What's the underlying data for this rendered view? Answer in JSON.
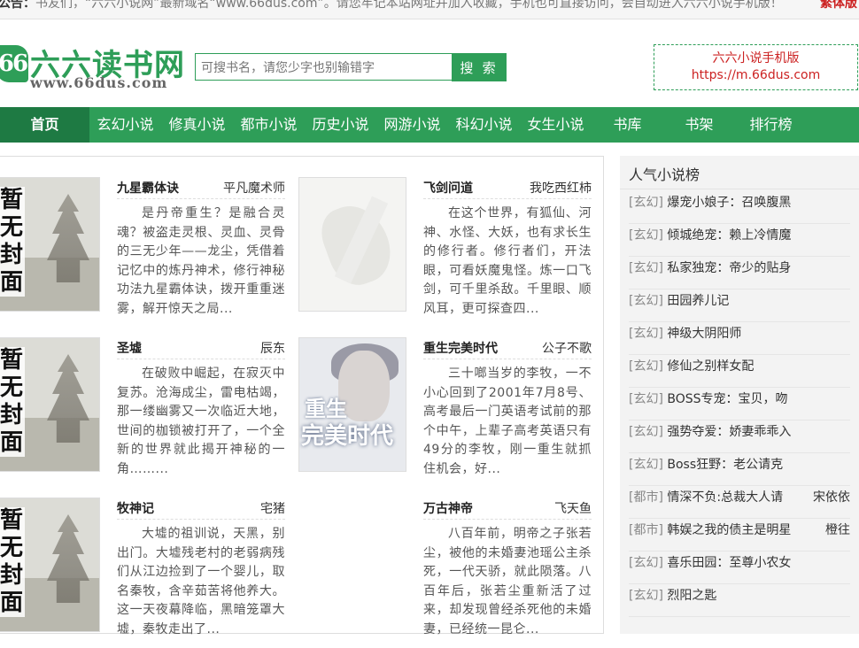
{
  "notice": {
    "prefix": "公告：",
    "text": "书友们，“六六小说网”最新域名“www.66dus.com”。请您牢记本站网址并加入收藏，手机也可直接访问，会自动进入六六小说手机版！",
    "trad_link": "繁体版"
  },
  "header": {
    "logo_badge": "66",
    "logo_name": "六六读书网",
    "logo_url": "www.66dus.com",
    "search_placeholder": "可搜书名，请您少字也别输错字",
    "search_button": "搜 索",
    "mobile_title": "六六小说手机版",
    "mobile_url": "https://m.66dus.com"
  },
  "nav": [
    "首页",
    "玄幻小说",
    "修真小说",
    "都市小说",
    "历史小说",
    "网游小说",
    "科幻小说",
    "女生小说",
    "书库",
    "书架",
    "排行榜"
  ],
  "covers": {
    "no_cover_caption": "暂无封面",
    "rebirth_tag": "重生",
    "rebirth_big": "完美时代"
  },
  "books": [
    {
      "title": "九星霸体诀",
      "author": "平凡魔术师",
      "desc": "是丹帝重生？是融合灵魂？被盗走灵根、灵血、灵骨的三无少年——龙尘，凭借着记忆中的炼丹神术，修行神秘功法九星霸体诀，拨开重重迷雾，解开惊天之局..."
    },
    {
      "title": "飞剑问道",
      "author": "我吃西红柿",
      "desc": "在这个世界，有狐仙、河神、水怪、大妖，也有求长生的修行者。修行者们，开法眼，可看妖魔鬼怪。炼一口飞剑，可千里杀敌。千里眼、顺风耳，更可探查四..."
    },
    {
      "title": "圣墟",
      "author": "辰东",
      "desc": "在破败中崛起，在寂灭中复苏。沧海成尘，雷电枯竭，那一缕幽雾又一次临近大地，世间的枷锁被打开了，一个全新的世界就此揭开神秘的一角……..."
    },
    {
      "title": "重生完美时代",
      "author": "公子不歌",
      "desc": "三十啷当岁的李牧，一不小心回到了2001年7月8号、高考最后一门英语考试前的那个中午，上辈子高考英语只有49分的李牧，刚一重生就抓住机会，好..."
    },
    {
      "title": "牧神记",
      "author": "宅猪",
      "desc": "大墟的祖训说，天黑，别出门。大墟残老村的老弱病残们从江边捡到了一个婴儿，取名秦牧，含辛茹苦将他养大。这一天夜幕降临，黑暗笼罩大墟，秦牧走出了..."
    },
    {
      "title": "万古神帝",
      "author": "飞天鱼",
      "desc": "八百年前，明帝之子张若尘，被他的未婚妻池瑶公主杀死，一代天骄，就此陨落。八百年后，张若尘重新活了过来，却发现曾经杀死他的未婚妻，已经统一昆仑..."
    }
  ],
  "sidebar": {
    "title": "人气小说榜",
    "items": [
      {
        "cat": "[玄幻]",
        "book": "爆宠小娘子：召唤腹黑",
        "author": ""
      },
      {
        "cat": "[玄幻]",
        "book": "倾城绝宠：赖上冷情魔",
        "author": ""
      },
      {
        "cat": "[玄幻]",
        "book": "私家独宠：帝少的贴身",
        "author": ""
      },
      {
        "cat": "[玄幻]",
        "book": "田园养儿记",
        "author": ""
      },
      {
        "cat": "[玄幻]",
        "book": "神级大阴阳师",
        "author": ""
      },
      {
        "cat": "[玄幻]",
        "book": "修仙之别样女配",
        "author": ""
      },
      {
        "cat": "[玄幻]",
        "book": "BOSS专宠：宝贝，吻",
        "author": ""
      },
      {
        "cat": "[玄幻]",
        "book": "强势夺爱：娇妻乖乖入",
        "author": ""
      },
      {
        "cat": "[玄幻]",
        "book": "Boss狂野：老公请克",
        "author": ""
      },
      {
        "cat": "[都市]",
        "book": "情深不负:总裁大人请",
        "author": "宋依依"
      },
      {
        "cat": "[都市]",
        "book": "韩娱之我的债主是明星",
        "author": "橙往"
      },
      {
        "cat": "[玄幻]",
        "book": "喜乐田园：至尊小农女",
        "author": ""
      },
      {
        "cat": "[玄幻]",
        "book": "烈阳之匙",
        "author": ""
      }
    ]
  },
  "colors": {
    "brand_green": "#2e9e58",
    "nav_active": "#1e7a43",
    "accent_red": "#cc2222"
  }
}
